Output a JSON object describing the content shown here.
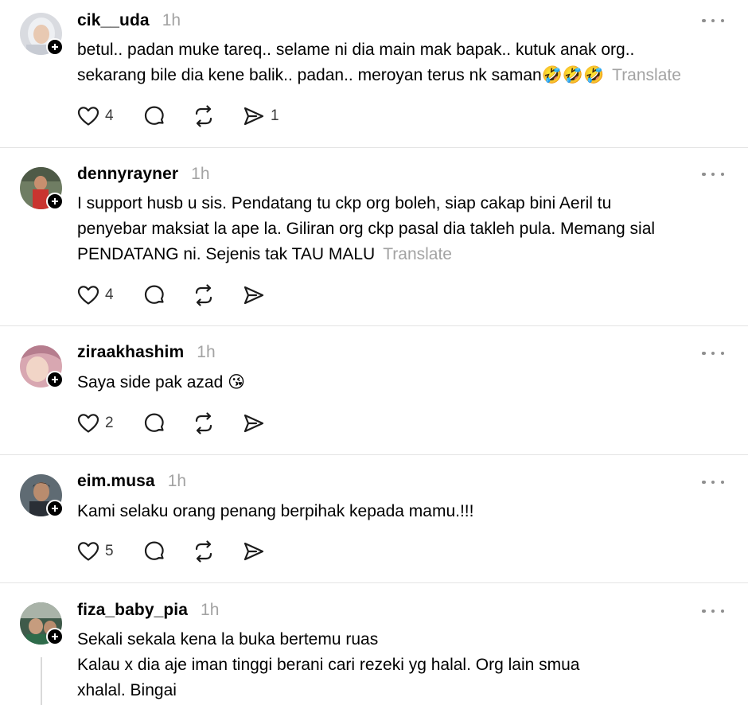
{
  "posts": [
    {
      "username": "cik__uda",
      "time": "1h",
      "lines": [
        "betul.. padan muke tareq.. selame ni dia main mak bapak.. kutuk anak org..",
        "sekarang bile dia kene balik.. padan.. meroyan terus nk saman"
      ],
      "emoji_tail": "🤣🤣🤣",
      "translate": "Translate",
      "likes": "4",
      "reposts": "",
      "shares": "1"
    },
    {
      "username": "dennyrayner",
      "time": "1h",
      "lines": [
        "I support husb u sis. Pendatang tu ckp org boleh, siap cakap bini Aeril tu",
        "penyebar maksiat la ape la. Giliran org ckp pasal dia takleh pula. Memang sial",
        "PENDATANG ni. Sejenis tak TAU MALU"
      ],
      "translate": "Translate",
      "likes": "4",
      "shares": ""
    },
    {
      "username": "ziraakhashim",
      "time": "1h",
      "lines": [
        "Saya side pak azad "
      ],
      "emoji_tail": "😘",
      "likes": "2",
      "shares": ""
    },
    {
      "username": "eim.musa",
      "time": "1h",
      "lines": [
        "Kami selaku orang penang berpihak kepada mamu.!!!"
      ],
      "likes": "5",
      "shares": ""
    },
    {
      "username": "fiza_baby_pia",
      "time": "1h",
      "lines": [
        "Sekali sekala kena la buka bertemu ruas",
        "Kalau x dia aje iman tinggi berani cari rezeki yg halal. Org lain smua",
        "xhalal. Bingai"
      ]
    }
  ],
  "colors": {
    "muted": "#a3a3a3",
    "divider": "#e4e4e4",
    "text": "#000000",
    "icon": "#1c1c1c"
  },
  "icons": [
    "heart-icon",
    "comment-icon",
    "repost-icon",
    "share-icon",
    "more-icon",
    "follow-plus-icon"
  ]
}
